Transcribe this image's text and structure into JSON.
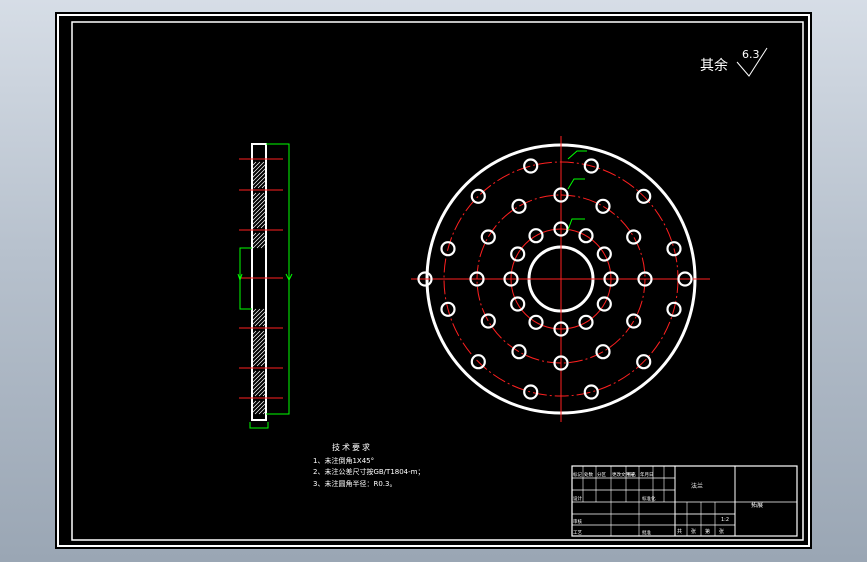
{
  "roughness": {
    "prefix": "其余",
    "value": "6.3"
  },
  "notes": {
    "title": "技术要求",
    "items": [
      "1、未注倒角1X45°",
      "2、未注公差尺寸按GB/T1804-m；",
      "3、未注圆角半径：R0.3。"
    ]
  },
  "title_block": {
    "part_label": "法兰",
    "company": "拓展",
    "scale": "1:2",
    "rows": [
      [
        "标记",
        "处数",
        "分区",
        "更改文件号",
        "签名",
        "年月日"
      ],
      [
        "设计",
        "",
        "",
        "标准化",
        "",
        ""
      ],
      [
        "审核",
        "",
        "",
        "",
        "",
        ""
      ],
      [
        "工艺",
        "",
        "",
        "批准",
        "",
        ""
      ]
    ],
    "footer": [
      "共",
      "张",
      "第",
      "张"
    ]
  },
  "colors": {
    "background": "#000000",
    "outline": "#ffffff",
    "center_lines": "#ff2020",
    "dimensions": "#00ff00",
    "hatch": "#ffffff"
  }
}
